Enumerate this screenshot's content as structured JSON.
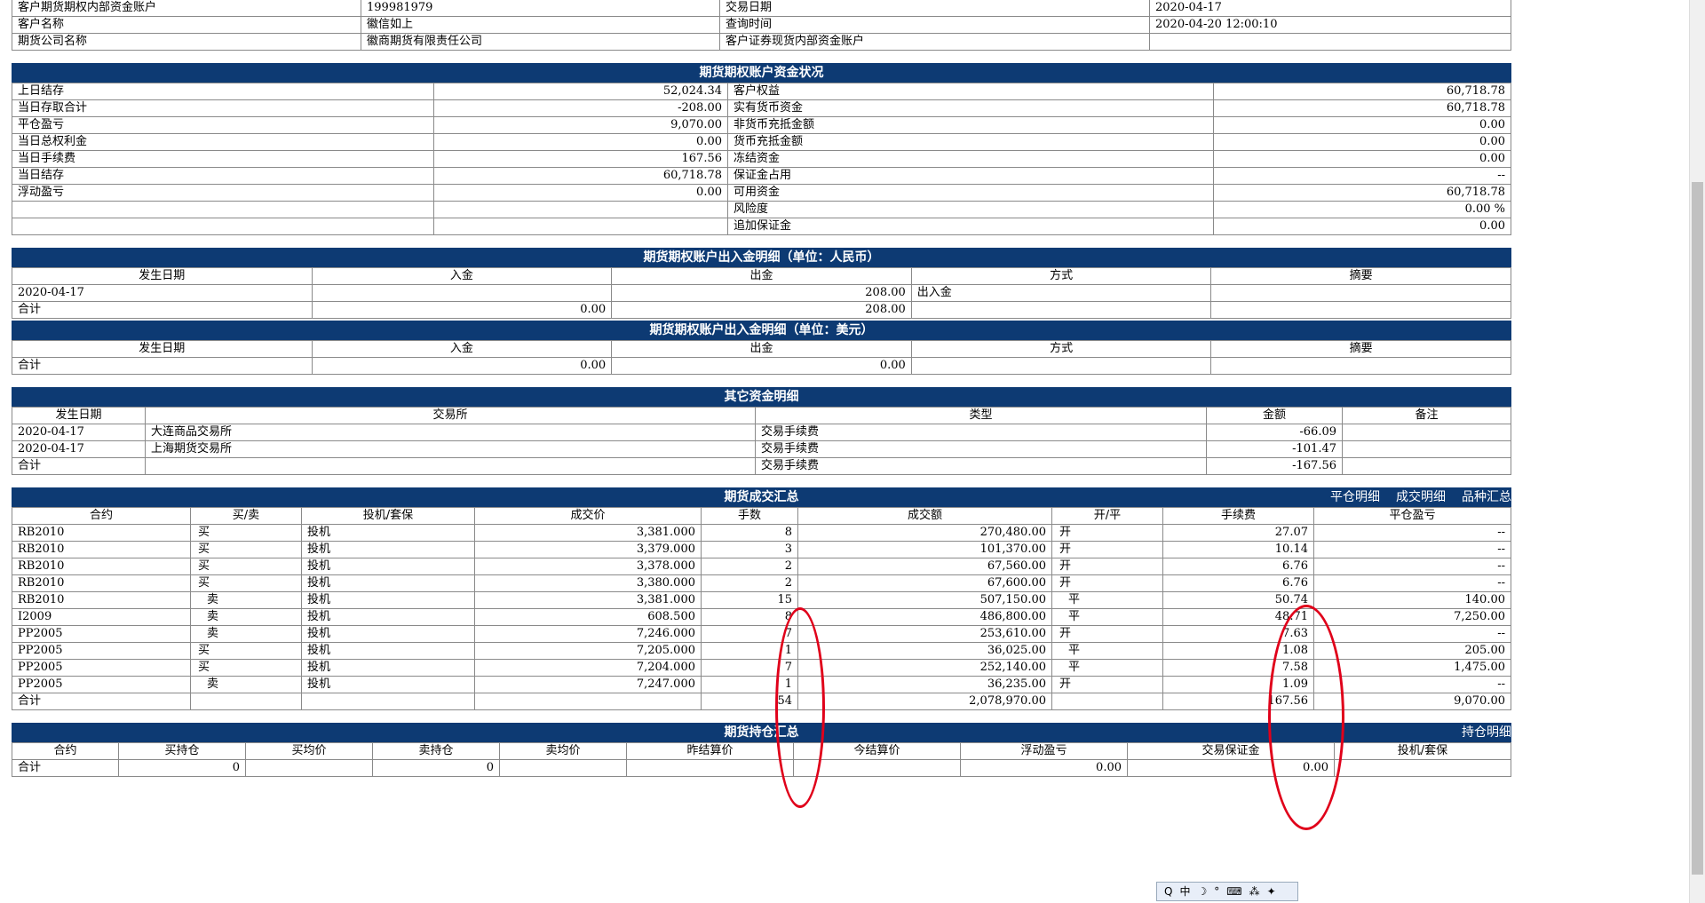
{
  "top_info": {
    "rows": [
      [
        "客户期货期权内部资金账户",
        "199981979",
        "交易日期",
        "2020-04-17"
      ],
      [
        "客户名称",
        "徽信如上",
        "查询时间",
        "2020-04-20 12:00:10"
      ],
      [
        "期货公司名称",
        "徽商期货有限责任公司",
        "客户证券现货内部资金账户",
        ""
      ]
    ]
  },
  "fund_status": {
    "title": "期货期权账户资金状况",
    "rows": [
      [
        "上日结存",
        "52,024.34",
        "客户权益",
        "60,718.78"
      ],
      [
        "当日存取合计",
        "-208.00",
        "实有货币资金",
        "60,718.78"
      ],
      [
        "平仓盈亏",
        "9,070.00",
        "非货币充抵金额",
        "0.00"
      ],
      [
        "当日总权利金",
        "0.00",
        "货币充抵金额",
        "0.00"
      ],
      [
        "当日手续费",
        "167.56",
        "冻结资金",
        "0.00"
      ],
      [
        "当日结存",
        "60,718.78",
        "保证金占用",
        "--"
      ],
      [
        "浮动盈亏",
        "0.00",
        "可用资金",
        "60,718.78"
      ],
      [
        "",
        "",
        "风险度",
        "0.00 %"
      ],
      [
        "",
        "",
        "追加保证金",
        "0.00"
      ]
    ]
  },
  "cash_rmb": {
    "title": "期货期权账户出入金明细（单位：人民币）",
    "headers": [
      "发生日期",
      "入金",
      "出金",
      "方式",
      "摘要"
    ],
    "rows": [
      [
        "2020-04-17",
        "",
        "208.00",
        "出入金",
        ""
      ],
      [
        "合计",
        "0.00",
        "208.00",
        "",
        ""
      ]
    ]
  },
  "cash_usd": {
    "title": "期货期权账户出入金明细（单位：美元）",
    "headers": [
      "发生日期",
      "入金",
      "出金",
      "方式",
      "摘要"
    ],
    "rows": [
      [
        "合计",
        "0.00",
        "0.00",
        "",
        ""
      ]
    ]
  },
  "other_funds": {
    "title": "其它资金明细",
    "headers": [
      "发生日期",
      "交易所",
      "类型",
      "金额",
      "备注"
    ],
    "rows": [
      [
        "2020-04-17",
        "大连商品交易所",
        "交易手续费",
        "-66.09",
        ""
      ],
      [
        "2020-04-17",
        "上海期货交易所",
        "交易手续费",
        "-101.47",
        ""
      ],
      [
        "合计",
        "",
        "交易手续费",
        "-167.56",
        ""
      ]
    ]
  },
  "trade_summary": {
    "title": "期货成交汇总",
    "links": [
      "平仓明细",
      "成交明细",
      "品种汇总"
    ],
    "headers": [
      "合约",
      "买/卖",
      "投机/套保",
      "成交价",
      "手数",
      "成交额",
      "开/平",
      "手续费",
      "平仓盈亏"
    ],
    "rows": [
      [
        "RB2010",
        "买",
        "投机",
        "3,381.000",
        "8",
        "270,480.00",
        "开",
        "27.07",
        "--"
      ],
      [
        "RB2010",
        "买",
        "投机",
        "3,379.000",
        "3",
        "101,370.00",
        "开",
        "10.14",
        "--"
      ],
      [
        "RB2010",
        "买",
        "投机",
        "3,378.000",
        "2",
        "67,560.00",
        "开",
        "6.76",
        "--"
      ],
      [
        "RB2010",
        "买",
        "投机",
        "3,380.000",
        "2",
        "67,600.00",
        "开",
        "6.76",
        "--"
      ],
      [
        "RB2010",
        "卖",
        "投机",
        "3,381.000",
        "15",
        "507,150.00",
        "平",
        "50.74",
        "140.00"
      ],
      [
        "I2009",
        "卖",
        "投机",
        "608.500",
        "8",
        "486,800.00",
        "平",
        "48.71",
        "7,250.00"
      ],
      [
        "PP2005",
        "卖",
        "投机",
        "7,246.000",
        "7",
        "253,610.00",
        "开",
        "7.63",
        "--"
      ],
      [
        "PP2005",
        "买",
        "投机",
        "7,205.000",
        "1",
        "36,025.00",
        "平",
        "1.08",
        "205.00"
      ],
      [
        "PP2005",
        "买",
        "投机",
        "7,204.000",
        "7",
        "252,140.00",
        "平",
        "7.58",
        "1,475.00"
      ],
      [
        "PP2005",
        "卖",
        "投机",
        "7,247.000",
        "1",
        "36,235.00",
        "开",
        "1.09",
        "--"
      ]
    ],
    "total": [
      "合计",
      "",
      "",
      "",
      "54",
      "2,078,970.00",
      "",
      "167.56",
      "9,070.00"
    ]
  },
  "position_summary": {
    "title": "期货持仓汇总",
    "links": [
      "持仓明细"
    ],
    "headers": [
      "合约",
      "买持仓",
      "买均价",
      "卖持仓",
      "卖均价",
      "昨结算价",
      "今结算价",
      "浮动盈亏",
      "交易保证金",
      "投机/套保"
    ],
    "total": [
      "合计",
      "0",
      "",
      "0",
      "",
      "",
      "",
      "0.00",
      "0.00",
      ""
    ]
  },
  "ime_bar": {
    "items": [
      "Q",
      "中",
      "☽",
      "°",
      "⌨",
      "⁂",
      "✦"
    ]
  },
  "colors": {
    "header_bg": "#0d3a73",
    "annotation": "#e0001a"
  }
}
